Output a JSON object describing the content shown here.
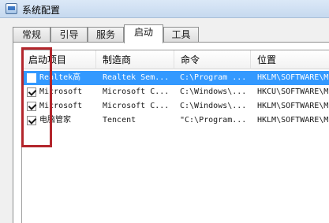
{
  "window": {
    "title": "系统配置"
  },
  "tabs": [
    {
      "label": "常规",
      "active": false
    },
    {
      "label": "引导",
      "active": false
    },
    {
      "label": "服务",
      "active": false
    },
    {
      "label": "启动",
      "active": true
    },
    {
      "label": "工具",
      "active": false
    }
  ],
  "columns": [
    "启动项目",
    "制造商",
    "命令",
    "位置"
  ],
  "rows": [
    {
      "item": "Realtek高",
      "maker": "Realtek Sem...",
      "command": "C:\\Program ...",
      "location": "HKLM\\SOFTWARE\\M...",
      "checked": false,
      "selected": true
    },
    {
      "item": "Microsoft",
      "maker": "Microsoft C...",
      "command": "C:\\Windows\\...",
      "location": "HKCU\\SOFTWARE\\M...",
      "checked": true,
      "selected": false
    },
    {
      "item": "Microsoft",
      "maker": "Microsoft C...",
      "command": "C:\\Windows\\...",
      "location": "HKLM\\SOFTWARE\\M...",
      "checked": true,
      "selected": false
    },
    {
      "item": "电脑管家",
      "maker": "Tencent",
      "command": "\"C:\\Program...",
      "location": "HKLM\\SOFTWARE\\M...",
      "checked": true,
      "selected": false
    }
  ],
  "colors": {
    "selection": "#3399ff",
    "annotation": "#b3262c"
  }
}
